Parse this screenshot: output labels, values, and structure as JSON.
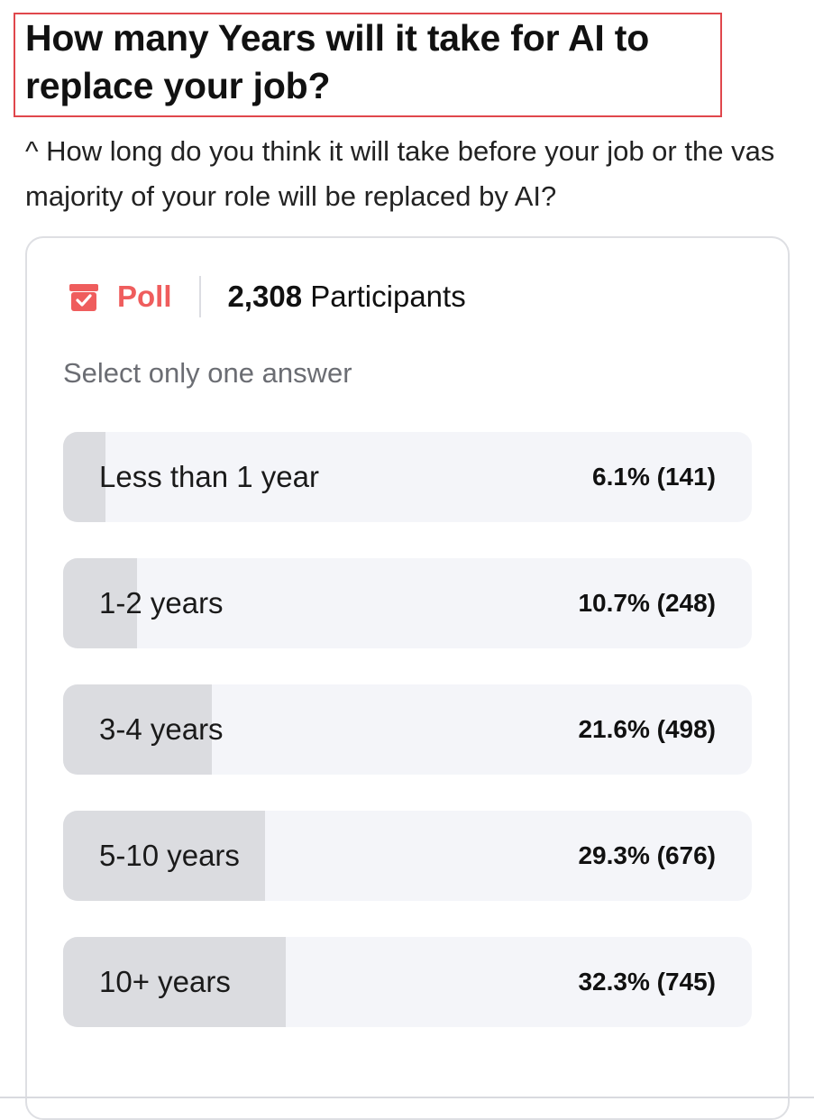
{
  "question": {
    "title": "How many Years will it take for AI to replace your job?",
    "description": "^ How long do you think it will take before your job or the vas majority of your role will be replaced by AI?"
  },
  "poll": {
    "icon": "poll-icon",
    "label": "Poll",
    "participant_count": "2,308",
    "participant_label": "Participants",
    "instruction": "Select only one answer",
    "accent_color": "#ef5d5d",
    "options": [
      {
        "label": "Less than 1 year",
        "stat": "6.1% (141)",
        "fraction": 0.061
      },
      {
        "label": "1-2 years",
        "stat": "10.7% (248)",
        "fraction": 0.107
      },
      {
        "label": "3-4 years",
        "stat": "21.6% (498)",
        "fraction": 0.216
      },
      {
        "label": "5-10 years",
        "stat": "29.3% (676)",
        "fraction": 0.293
      },
      {
        "label": "10+ years",
        "stat": "32.3% (745)",
        "fraction": 0.323
      }
    ]
  }
}
